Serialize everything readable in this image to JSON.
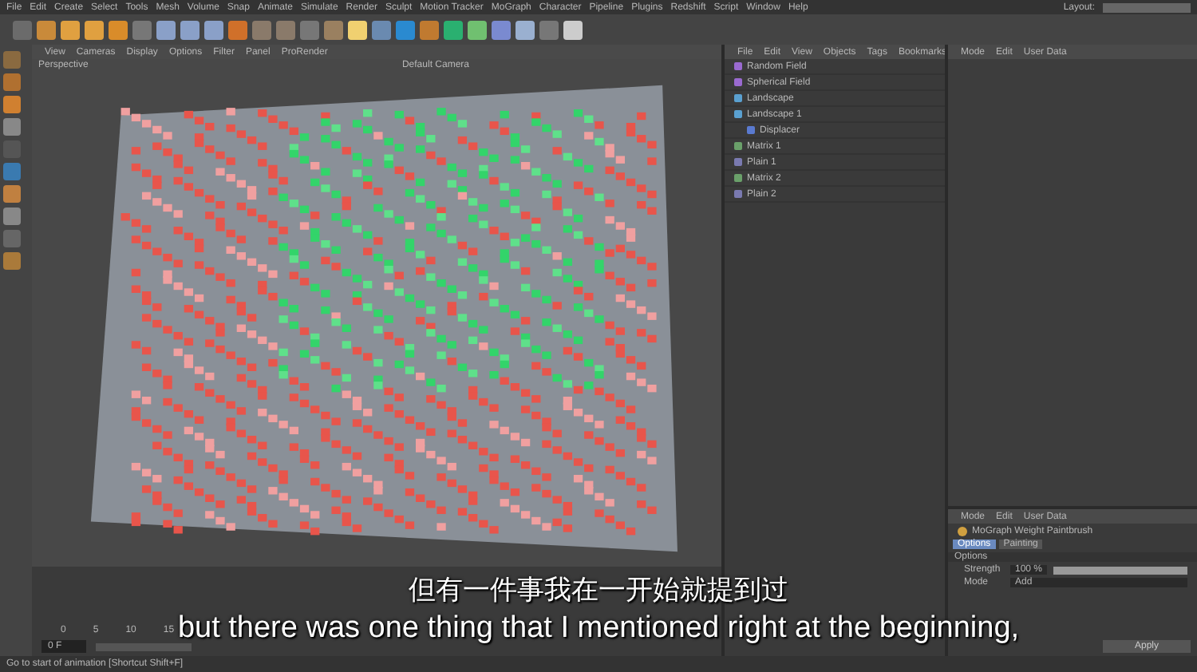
{
  "menubar": {
    "items": [
      "File",
      "Edit",
      "Create",
      "Select",
      "Tools",
      "Mesh",
      "Volume",
      "Snap",
      "Animate",
      "Simulate",
      "Render",
      "Sculpt",
      "Motion Tracker",
      "MoGraph",
      "Character",
      "Pipeline",
      "Plugins",
      "Redshift",
      "Script",
      "Window",
      "Help"
    ],
    "layout_label": "Layout:"
  },
  "viewport": {
    "menu": [
      "View",
      "Cameras",
      "Display",
      "Options",
      "Filter",
      "Panel",
      "ProRender"
    ],
    "view_name": "Perspective",
    "camera": "Default Camera"
  },
  "object_manager": {
    "menu": [
      "File",
      "Edit",
      "View",
      "Objects",
      "Tags",
      "Bookmarks"
    ],
    "objects": [
      {
        "name": "Random Field",
        "kind": "field"
      },
      {
        "name": "Spherical Field",
        "kind": "field"
      },
      {
        "name": "Landscape",
        "kind": "landscape"
      },
      {
        "name": "Landscape 1",
        "kind": "landscape",
        "children": [
          {
            "name": "Displacer",
            "kind": "deformer"
          }
        ]
      },
      {
        "name": "Matrix 1",
        "kind": "matrix"
      },
      {
        "name": "Plain 1",
        "kind": "effector"
      },
      {
        "name": "Matrix 2",
        "kind": "matrix"
      },
      {
        "name": "Plain 2",
        "kind": "effector"
      }
    ]
  },
  "attributes_top": {
    "menu": [
      "Mode",
      "Edit",
      "User Data"
    ]
  },
  "attributes_bottom": {
    "menu": [
      "Mode",
      "Edit",
      "User Data"
    ],
    "tool_name": "MoGraph Weight Paintbrush",
    "tabs": [
      {
        "label": "Options",
        "selected": true
      },
      {
        "label": "Painting",
        "selected": false
      }
    ],
    "section": "Options",
    "strength_label": "Strength",
    "strength_value": "100 %",
    "strength": {
      "level": 1
    },
    "mode_label": "Mode",
    "mode_value": "Add",
    "apply": "Apply"
  },
  "timeline": {
    "ticks": [
      "0",
      "5",
      "10",
      "15"
    ],
    "frame": "0 F"
  },
  "status_bar": "Go to start of animation [Shortcut Shift+F]",
  "subtitles": {
    "chinese": "但有一件事我在一开始就提到过",
    "english": "but there was one thing that I mentioned right at the beginning,"
  }
}
